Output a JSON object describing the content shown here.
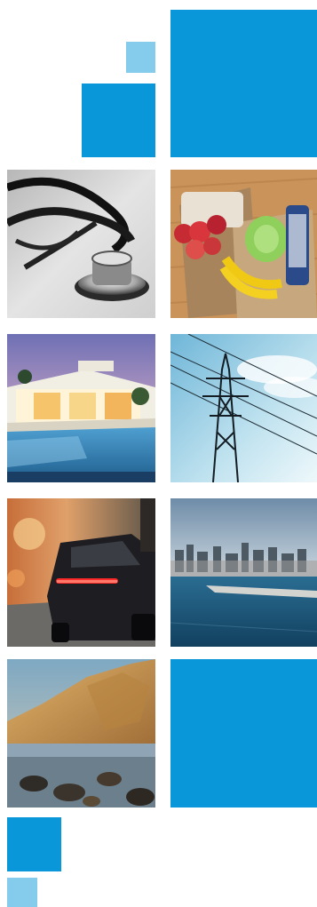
{
  "colors": {
    "accent_blue": "#0a97d9",
    "accent_light_blue": "#84cbec",
    "background": "#ffffff"
  },
  "tiles": [
    {
      "name": "blue-square-top-right",
      "kind": "solid",
      "color": "accent_blue"
    },
    {
      "name": "small-light-blue-square-top",
      "kind": "solid",
      "color": "accent_light_blue"
    },
    {
      "name": "medium-blue-square-top",
      "kind": "solid",
      "color": "accent_blue"
    },
    {
      "name": "photo-stethoscope",
      "kind": "photo",
      "subject": "stethoscope"
    },
    {
      "name": "photo-grocery-bags",
      "kind": "photo",
      "subject": "grocery-bags"
    },
    {
      "name": "photo-luxury-house-pool",
      "kind": "photo",
      "subject": "luxury-house-with-pool"
    },
    {
      "name": "photo-power-line-tower",
      "kind": "photo",
      "subject": "power-line-tower"
    },
    {
      "name": "photo-sports-car",
      "kind": "photo",
      "subject": "sports-car"
    },
    {
      "name": "photo-city-waterfront",
      "kind": "photo",
      "subject": "city-waterfront"
    },
    {
      "name": "photo-coastal-cliff",
      "kind": "photo",
      "subject": "coastal-cliff"
    },
    {
      "name": "blue-square-bottom-right",
      "kind": "solid",
      "color": "accent_blue"
    },
    {
      "name": "medium-blue-square-bottom",
      "kind": "solid",
      "color": "accent_blue"
    },
    {
      "name": "small-light-blue-square-bottom",
      "kind": "solid",
      "color": "accent_light_blue"
    }
  ]
}
